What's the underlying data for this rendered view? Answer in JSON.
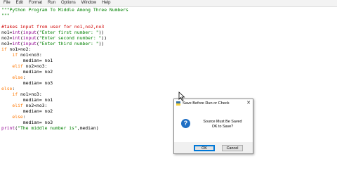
{
  "menu": [
    "File",
    "Edit",
    "Format",
    "Run",
    "Options",
    "Window",
    "Help"
  ],
  "code": [
    {
      "segments": [
        {
          "t": "\"\"\"Python Program To Middle Among Three Numbers",
          "c": "str"
        }
      ]
    },
    {
      "segments": [
        {
          "t": "\"\"\"",
          "c": "str"
        }
      ]
    },
    {
      "segments": []
    },
    {
      "segments": [
        {
          "t": "#takes input from user for no1,no2,no3",
          "c": "com"
        }
      ]
    },
    {
      "segments": [
        {
          "t": "no1=",
          "c": ""
        },
        {
          "t": "int",
          "c": "blt"
        },
        {
          "t": "(",
          "c": ""
        },
        {
          "t": "input",
          "c": "blt"
        },
        {
          "t": "(",
          "c": ""
        },
        {
          "t": "\"Enter first number: \"",
          "c": "str"
        },
        {
          "t": "))",
          "c": ""
        }
      ]
    },
    {
      "segments": [
        {
          "t": "no2=",
          "c": ""
        },
        {
          "t": "int",
          "c": "blt"
        },
        {
          "t": "(",
          "c": ""
        },
        {
          "t": "input",
          "c": "blt"
        },
        {
          "t": "(",
          "c": ""
        },
        {
          "t": "\"Enter second number: \"",
          "c": "str"
        },
        {
          "t": "))",
          "c": ""
        }
      ]
    },
    {
      "segments": [
        {
          "t": "no3=",
          "c": ""
        },
        {
          "t": "int",
          "c": "blt"
        },
        {
          "t": "(",
          "c": ""
        },
        {
          "t": "input",
          "c": "blt"
        },
        {
          "t": "(",
          "c": ""
        },
        {
          "t": "\"Enter third number: \"",
          "c": "str"
        },
        {
          "t": "))",
          "c": ""
        }
      ]
    },
    {
      "segments": [
        {
          "t": "if",
          "c": "kw"
        },
        {
          "t": " no1>no2:",
          "c": ""
        }
      ]
    },
    {
      "segments": [
        {
          "t": "    ",
          "c": ""
        },
        {
          "t": "if",
          "c": "kw"
        },
        {
          "t": " no1<no3:",
          "c": ""
        }
      ]
    },
    {
      "segments": [
        {
          "t": "        median= no1",
          "c": ""
        }
      ]
    },
    {
      "segments": [
        {
          "t": "    ",
          "c": ""
        },
        {
          "t": "elif",
          "c": "kw"
        },
        {
          "t": " no2>no3:",
          "c": ""
        }
      ]
    },
    {
      "segments": [
        {
          "t": "        median= no2",
          "c": ""
        }
      ]
    },
    {
      "segments": [
        {
          "t": "    ",
          "c": ""
        },
        {
          "t": "else",
          "c": "kw"
        },
        {
          "t": ":",
          "c": ""
        }
      ]
    },
    {
      "segments": [
        {
          "t": "        median= no3",
          "c": ""
        }
      ]
    },
    {
      "segments": [
        {
          "t": "else",
          "c": "kw"
        },
        {
          "t": ":",
          "c": ""
        }
      ]
    },
    {
      "segments": [
        {
          "t": "    ",
          "c": ""
        },
        {
          "t": "if",
          "c": "kw"
        },
        {
          "t": " no1>no3:",
          "c": ""
        }
      ]
    },
    {
      "segments": [
        {
          "t": "        median= no1",
          "c": ""
        }
      ]
    },
    {
      "segments": [
        {
          "t": "    ",
          "c": ""
        },
        {
          "t": "elif",
          "c": "kw"
        },
        {
          "t": " no2<no3:",
          "c": ""
        }
      ]
    },
    {
      "segments": [
        {
          "t": "        median= no2",
          "c": ""
        }
      ]
    },
    {
      "segments": [
        {
          "t": "    ",
          "c": ""
        },
        {
          "t": "else",
          "c": "kw"
        },
        {
          "t": ":",
          "c": ""
        }
      ]
    },
    {
      "segments": [
        {
          "t": "        median= no3",
          "c": ""
        }
      ]
    },
    {
      "segments": [
        {
          "t": "print",
          "c": "blt"
        },
        {
          "t": "(",
          "c": ""
        },
        {
          "t": "\"The middle number is\"",
          "c": "str"
        },
        {
          "t": ",median)",
          "c": ""
        }
      ]
    }
  ],
  "dialog": {
    "title": "Save Before Run or Check",
    "close": "✕",
    "message_line1": "Source Must Be Saved",
    "message_line2": "OK to Save?",
    "icon": "question-icon",
    "ok_label": "OK",
    "cancel_label": "Cancel"
  },
  "colors": {
    "string": "#008000",
    "comment": "#d00000",
    "keyword": "#ff7700",
    "builtin": "#900090"
  }
}
